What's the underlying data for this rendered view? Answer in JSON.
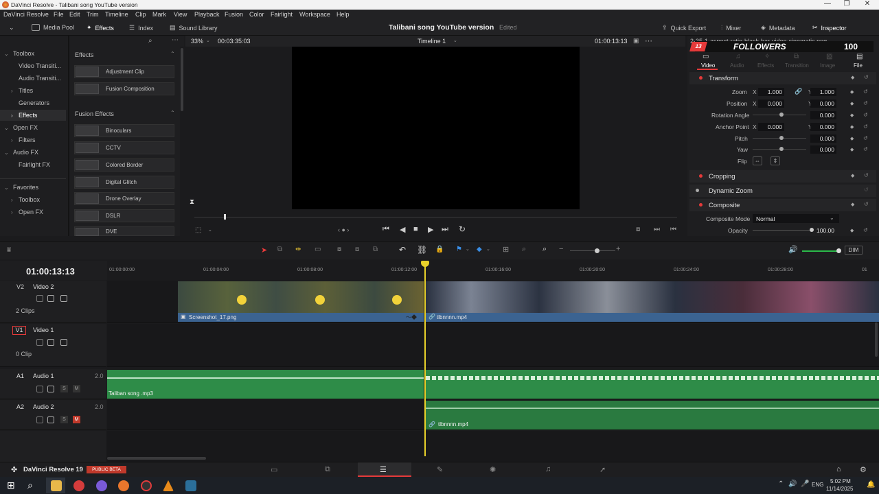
{
  "window": {
    "title": "DaVinci Resolve - Talibani song YouTube version"
  },
  "menu": [
    "DaVinci Resolve",
    "File",
    "Edit",
    "Trim",
    "Timeline",
    "Clip",
    "Mark",
    "View",
    "Playback",
    "Fusion",
    "Color",
    "Fairlight",
    "Workspace",
    "Help"
  ],
  "toolbar": {
    "media_pool": "Media Pool",
    "effects": "Effects",
    "index": "Index",
    "sound_library": "Sound Library",
    "project_title": "Talibani song YouTube version",
    "edited": "Edited",
    "quick_export": "Quick Export",
    "mixer": "Mixer",
    "metadata": "Metadata",
    "inspector": "Inspector"
  },
  "left_tree": {
    "toolbox": "Toolbox",
    "video_transitions": "Video Transiti...",
    "audio_transitions": "Audio Transiti...",
    "titles": "Titles",
    "generators": "Generators",
    "effects": "Effects",
    "open_fx": "Open FX",
    "filters": "Filters",
    "audio_fx": "Audio FX",
    "fairlight_fx": "Fairlight FX",
    "favorites": "Favorites",
    "fav_toolbox": "Toolbox",
    "fav_open_fx": "Open FX"
  },
  "effects_panel": {
    "header": "Effects",
    "items": [
      "Adjustment Clip",
      "Fusion Composition"
    ],
    "fusion_header": "Fusion Effects",
    "fusion_items": [
      "Binoculars",
      "CCTV",
      "Colored Border",
      "Digital Glitch",
      "Drone Overlay",
      "DSLR",
      "DVE"
    ]
  },
  "viewer": {
    "zoom": "33%",
    "duration": "00:03:35:03",
    "timeline_name": "Timeline 1",
    "timecode": "01:00:13:13",
    "clip_name": "2-35-1-aspect-ratio-black-bar-video-cinematic.png",
    "overlay_followers": "FOLLOWERS",
    "overlay_count": "100",
    "overlay_badge": "13"
  },
  "inspector": {
    "tabs": [
      "Video",
      "Audio",
      "Effects",
      "Transition",
      "Image",
      "File"
    ],
    "transform": "Transform",
    "zoom_label": "Zoom",
    "zoom_x": "1.000",
    "zoom_y": "1.000",
    "position_label": "Position",
    "position_x": "0.000",
    "position_y": "0.000",
    "rotation_label": "Rotation Angle",
    "rotation": "0.000",
    "anchor_label": "Anchor Point",
    "anchor_x": "0.000",
    "anchor_y": "0.000",
    "pitch_label": "Pitch",
    "pitch": "0.000",
    "yaw_label": "Yaw",
    "yaw": "0.000",
    "flip_label": "Flip",
    "x": "X",
    "y": "Y",
    "cropping": "Cropping",
    "dynamic_zoom": "Dynamic Zoom",
    "composite": "Composite",
    "composite_mode_label": "Composite Mode",
    "composite_mode": "Normal",
    "opacity_label": "Opacity",
    "opacity": "100.00"
  },
  "timeline": {
    "timecode": "01:00:13:13",
    "dim": "DIM",
    "ruler": [
      "01:00:00:00",
      "01:00:04:00",
      "01:00:08:00",
      "01:00:12:00",
      "01:00:16:00",
      "01:00:20:00",
      "01:00:24:00",
      "01:00:28:00",
      "01"
    ],
    "tracks": {
      "v2": {
        "id": "V2",
        "name": "Video 2",
        "clips": "2 Clips"
      },
      "v1": {
        "id": "V1",
        "name": "Video 1",
        "clips": "0 Clip"
      },
      "a1": {
        "id": "A1",
        "name": "Audio 1",
        "ch": "2.0"
      },
      "a2": {
        "id": "A2",
        "name": "Audio 2",
        "ch": "2.0"
      }
    },
    "s": "S",
    "m": "M",
    "clip_screenshot": "Screenshot_17.png",
    "clip_video": "tlbnnnn.mp4",
    "clip_audio1": "Taliban song .mp3",
    "clip_audio2": "tlbnnnn.mp4"
  },
  "footer": {
    "app": "DaVinci Resolve 19",
    "beta": "PUBLIC BETA"
  },
  "taskbar": {
    "lang": "ENG",
    "time": "5:02 PM",
    "date": "11/14/2025"
  },
  "colors": {
    "accent": "#e63a3a",
    "video_clip": "#3b6391",
    "audio_clip": "#2e8c48",
    "playhead": "#e8d12a"
  }
}
